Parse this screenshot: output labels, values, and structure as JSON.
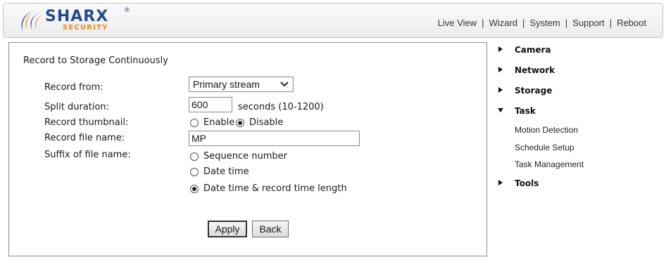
{
  "brand": {
    "name": "SHARX",
    "registered": "®",
    "tagline": "SECURITY",
    "colors": {
      "primary": "#274a8f",
      "accent": "#e58a12"
    }
  },
  "topnav": {
    "items": [
      "Live View",
      "Wizard",
      "System",
      "Support",
      "Reboot"
    ],
    "separator": "|"
  },
  "panel": {
    "title": "Record to Storage Continuously",
    "fields": {
      "record_from": {
        "label": "Record from:",
        "value": "Primary stream"
      },
      "split_duration": {
        "label": "Split duration:",
        "value": "600",
        "hint": "seconds (10-1200)"
      },
      "record_thumbnail": {
        "label": "Record thumbnail:",
        "options": [
          "Enable",
          "Disable"
        ],
        "selected": "Disable"
      },
      "record_file_name": {
        "label": "Record file name:",
        "value": "MP"
      },
      "suffix": {
        "label": "Suffix of file name:",
        "options": [
          "Sequence number",
          "Date time",
          "Date time & record time length"
        ],
        "selected": "Date time & record time length"
      }
    },
    "buttons": {
      "apply": "Apply",
      "back": "Back"
    }
  },
  "menu": {
    "items": [
      "Camera",
      "Network",
      "Storage",
      "Task",
      "Tools"
    ],
    "expanded": "Task",
    "task_subitems": [
      "Motion Detection",
      "Schedule Setup",
      "Task Management"
    ]
  },
  "icons": {
    "logo": "sharx-swoosh-logo",
    "select_arrow": "chevron-down-icon",
    "menu_collapsed": "triangle-right-icon",
    "menu_expanded": "triangle-down-icon"
  }
}
